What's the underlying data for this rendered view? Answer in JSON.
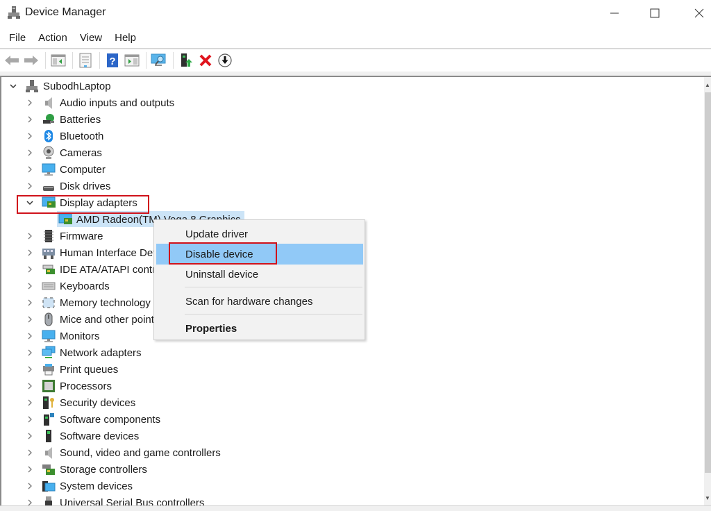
{
  "window": {
    "title": "Device Manager",
    "controls": {
      "minimize": "minimize",
      "maximize": "maximize",
      "close": "close"
    }
  },
  "menubar": {
    "items": [
      "File",
      "Action",
      "View",
      "Help"
    ]
  },
  "toolbar": {
    "buttons": [
      {
        "icon": "back-arrow-icon",
        "label": "Back"
      },
      {
        "icon": "forward-arrow-icon",
        "label": "Forward"
      },
      {
        "icon": "show-hide-console-tree-icon",
        "label": "Show/Hide Console Tree"
      },
      {
        "icon": "properties-icon",
        "label": "Properties"
      },
      {
        "icon": "help-icon",
        "label": "Help"
      },
      {
        "icon": "show-hide-action-pane-icon",
        "label": "Show/Hide Action Pane"
      },
      {
        "icon": "scan-hardware-icon",
        "label": "Scan for hardware changes"
      },
      {
        "icon": "update-driver-icon",
        "label": "Update driver"
      },
      {
        "icon": "uninstall-icon",
        "label": "Uninstall device"
      },
      {
        "icon": "disable-icon",
        "label": "Disable device"
      }
    ]
  },
  "tree": {
    "root": {
      "label": "SubodhLaptop",
      "expanded": true,
      "icon": "computer-root-icon"
    },
    "categories": [
      {
        "label": "Audio inputs and outputs",
        "icon": "speaker-icon",
        "expanded": false
      },
      {
        "label": "Batteries",
        "icon": "battery-icon",
        "expanded": false
      },
      {
        "label": "Bluetooth",
        "icon": "bluetooth-icon",
        "expanded": false
      },
      {
        "label": "Cameras",
        "icon": "camera-icon",
        "expanded": false
      },
      {
        "label": "Computer",
        "icon": "monitor-icon",
        "expanded": false
      },
      {
        "label": "Disk drives",
        "icon": "disk-drive-icon",
        "expanded": false
      },
      {
        "label": "Display adapters",
        "icon": "display-adapter-icon",
        "expanded": true,
        "children": [
          {
            "label": "AMD Radeon(TM) Vega 8 Graphics",
            "icon": "display-adapter-icon",
            "selected": true
          }
        ]
      },
      {
        "label": "Firmware",
        "icon": "firmware-icon",
        "expanded": false
      },
      {
        "label": "Human Interface Devices",
        "icon": "hid-icon",
        "expanded": false
      },
      {
        "label": "IDE ATA/ATAPI controllers",
        "icon": "ide-controller-icon",
        "expanded": false
      },
      {
        "label": "Keyboards",
        "icon": "keyboard-icon",
        "expanded": false
      },
      {
        "label": "Memory technology devices",
        "icon": "memory-icon",
        "expanded": false
      },
      {
        "label": "Mice and other pointing devices",
        "icon": "mouse-icon",
        "expanded": false
      },
      {
        "label": "Monitors",
        "icon": "monitor-icon",
        "expanded": false
      },
      {
        "label": "Network adapters",
        "icon": "network-icon",
        "expanded": false
      },
      {
        "label": "Print queues",
        "icon": "printer-icon",
        "expanded": false
      },
      {
        "label": "Processors",
        "icon": "processor-icon",
        "expanded": false
      },
      {
        "label": "Security devices",
        "icon": "security-icon",
        "expanded": false
      },
      {
        "label": "Software components",
        "icon": "software-component-icon",
        "expanded": false
      },
      {
        "label": "Software devices",
        "icon": "software-device-icon",
        "expanded": false
      },
      {
        "label": "Sound, video and game controllers",
        "icon": "speaker-icon",
        "expanded": false
      },
      {
        "label": "Storage controllers",
        "icon": "storage-controller-icon",
        "expanded": false
      },
      {
        "label": "System devices",
        "icon": "system-folder-icon",
        "expanded": false
      },
      {
        "label": "Universal Serial Bus controllers",
        "icon": "usb-icon",
        "expanded": false
      }
    ]
  },
  "context_menu": {
    "items": [
      {
        "label": "Update driver"
      },
      {
        "label": "Disable device",
        "highlighted": true
      },
      {
        "label": "Uninstall device"
      },
      {
        "label": "Scan for hardware changes"
      },
      {
        "label": "Properties",
        "bold": true
      }
    ]
  },
  "annotations": {
    "highlight_color": "#d0121b",
    "targets": [
      "Display adapters",
      "Disable device"
    ]
  },
  "colors": {
    "selection": "#cce4f7",
    "menu_hover": "#91c9f7",
    "menu_bg": "#f2f2f2"
  }
}
